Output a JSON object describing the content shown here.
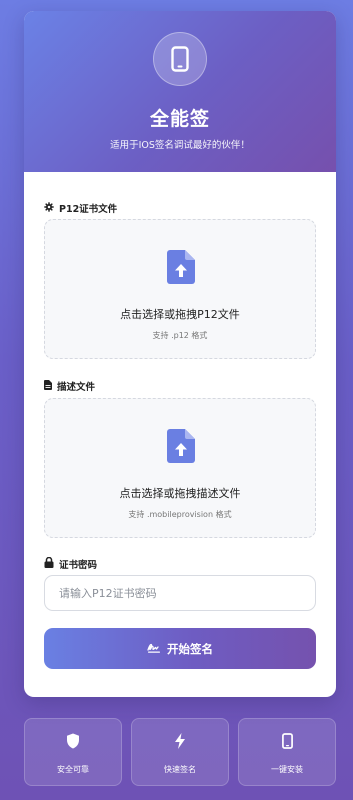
{
  "header": {
    "icon": "mobile-phone-icon",
    "title": "全能签",
    "subtitle": "适用于IOS签名调试最好的伙伴！"
  },
  "p12": {
    "label": "P12证书文件",
    "label_icon": "gear-icon",
    "dropzone_icon": "file-upload-icon",
    "dropzone_text": "点击选择或拖拽P12文件",
    "hint": "支持 .p12 格式"
  },
  "profile": {
    "label": "描述文件",
    "label_icon": "file-icon",
    "dropzone_icon": "file-upload-icon",
    "dropzone_text": "点击选择或拖拽描述文件",
    "hint": "支持 .mobileprovision 格式"
  },
  "password": {
    "label": "证书密码",
    "label_icon": "lock-icon",
    "placeholder": "请输入P12证书密码",
    "value": ""
  },
  "sign_button": {
    "label": "开始签名",
    "icon": "signature-icon"
  },
  "features": [
    {
      "icon": "shield-icon",
      "label": "安全可靠"
    },
    {
      "icon": "lightning-icon",
      "label": "快速签名"
    },
    {
      "icon": "mobile-phone-icon",
      "label": "一键安装"
    }
  ],
  "colors": {
    "accent_start": "#6b82e6",
    "accent_end": "#7650ad",
    "icon_blue": "#6a7fe2"
  }
}
